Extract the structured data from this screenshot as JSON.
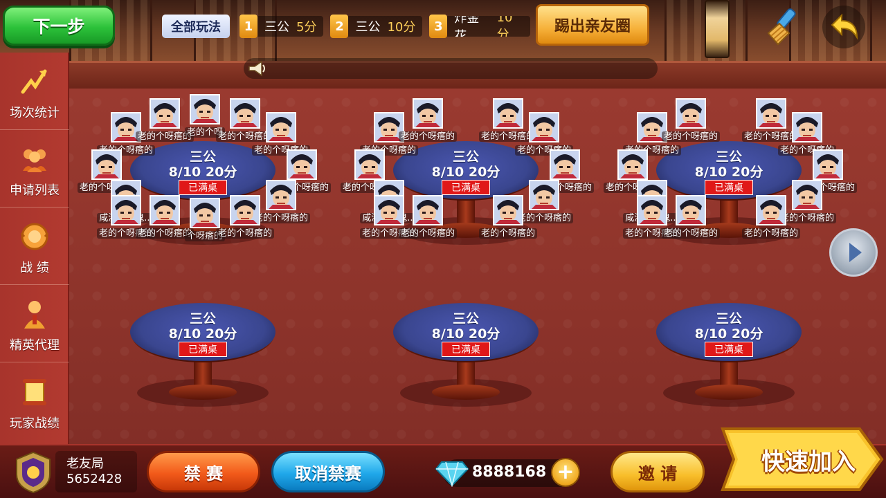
{
  "top_bar": {
    "next_step_label": "下一步",
    "all_modes_label": "全部玩法",
    "modes": [
      {
        "num": "1",
        "name": "三公",
        "score": "5分"
      },
      {
        "num": "2",
        "name": "三公",
        "score": "10分"
      },
      {
        "num": "3",
        "name": "炸金花",
        "score": "10分"
      }
    ],
    "kick_label": "踢出亲友圈",
    "icons": [
      "broom-icon",
      "back-arrow-icon",
      "horn-icon"
    ]
  },
  "sidebar": {
    "items": [
      {
        "label": "场次统计",
        "icon": "lightning-chart-icon"
      },
      {
        "label": "申请列表",
        "icon": "people-icon"
      },
      {
        "label": "战 绩",
        "icon": "record-icon"
      },
      {
        "label": "精英代理",
        "icon": "agent-icon"
      },
      {
        "label": "玩家战绩",
        "icon": "scroll-icon"
      }
    ]
  },
  "tables": [
    {
      "name": "三公",
      "info": "8/10 20分",
      "status": "已满桌"
    },
    {
      "name": "三公",
      "info": "8/10 20分",
      "status": "已满桌"
    },
    {
      "name": "三公",
      "info": "8/10 20分",
      "status": "已满桌"
    },
    {
      "name": "三公",
      "info": "8/10 20分",
      "status": "已满桌"
    },
    {
      "name": "三公",
      "info": "8/10 20分",
      "status": "已满桌"
    },
    {
      "name": "三公",
      "info": "8/10 20分",
      "status": "已满桌"
    }
  ],
  "players": {
    "default_name": "老的个呀瘩的",
    "alt_name": "咸湿屎忽鬼...",
    "partial_name_a": "老的个呀",
    "partial_name_b": "个呀瘩的"
  },
  "bottom": {
    "club_name": "老友局",
    "club_id": "5652428",
    "ban_label": "禁 赛",
    "unban_label": "取消禁赛",
    "diamonds": "8888168",
    "plus_label": "+",
    "invite_label": "邀 请",
    "quick_join_label": "快速加入"
  },
  "colors": {
    "accent_green": "#2cc23a",
    "accent_orange": "#f25a1a",
    "accent_blue": "#20a8ea",
    "accent_gold": "#f8be2a",
    "table_felt": "#3a468f",
    "status_red": "#e01818"
  }
}
